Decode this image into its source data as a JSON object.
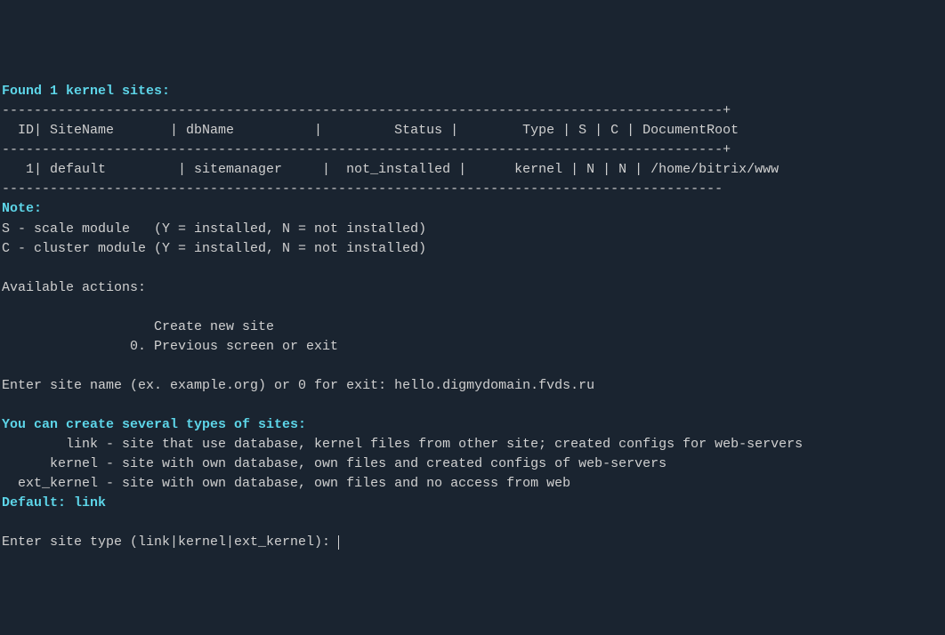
{
  "header": {
    "title": "Found 1 kernel sites:"
  },
  "table": {
    "divider": "------------------------------------------------------------------------------------------+",
    "divider2": "------------------------------------------------------------------------------------------",
    "header_row": "  ID| SiteName       | dbName          |         Status |        Type | S | C | DocumentRoot",
    "data_row": "   1| default         | sitemanager     |  not_installed |      kernel | N | N | /home/bitrix/www"
  },
  "note": {
    "label": "Note:",
    "line1": "S - scale module   (Y = installed, N = not installed)",
    "line2": "C - cluster module (Y = installed, N = not installed)"
  },
  "actions": {
    "header": "Available actions:",
    "line1": "                   Create new site",
    "line2": "                0. Previous screen or exit"
  },
  "prompt1": {
    "text": "Enter site name (ex. example.org) or 0 for exit: hello.digmydomain.fvds.ru"
  },
  "types": {
    "header": "You can create several types of sites:",
    "link": "        link - site that use database, kernel files from other site; created configs for web-servers",
    "kernel": "      kernel - site with own database, own files and created configs of web-servers",
    "ext_kernel": "  ext_kernel - site with own database, own files and no access from web"
  },
  "default": {
    "text": "Default: link"
  },
  "prompt2": {
    "text": "Enter site type (link|kernel|ext_kernel): "
  }
}
